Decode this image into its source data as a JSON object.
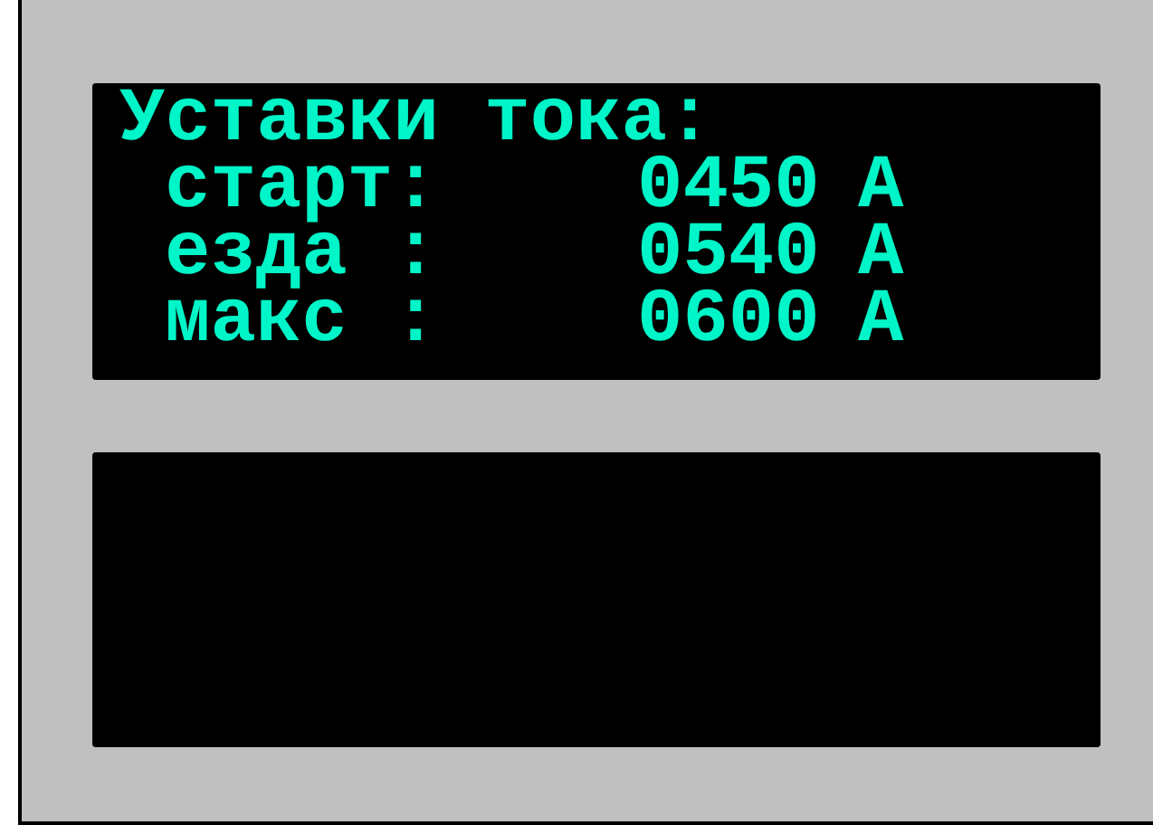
{
  "upper_display": {
    "title": "Уставки тока:",
    "rows": [
      {
        "label": "старт:",
        "value": "0450",
        "unit": "A"
      },
      {
        "label": "езда :",
        "value": "0540",
        "unit": "A"
      },
      {
        "label": "макс :",
        "value": "0600",
        "unit": "A"
      }
    ]
  }
}
